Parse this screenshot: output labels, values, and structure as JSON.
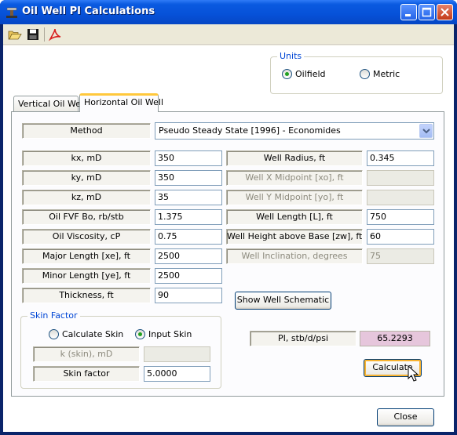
{
  "window": {
    "title": "Oil Well PI Calculations"
  },
  "toolbar": {
    "icons": [
      "open-folder-icon",
      "save-disk-icon",
      "pdf-icon"
    ]
  },
  "units": {
    "legend": "Units",
    "options": [
      {
        "label": "Oilfield",
        "selected": true
      },
      {
        "label": "Metric",
        "selected": false
      }
    ]
  },
  "tabs": [
    {
      "label": "Vertical Oil Well",
      "active": false
    },
    {
      "label": "Horizontal Oil Well",
      "active": true
    }
  ],
  "method": {
    "label": "Method",
    "value": "Pseudo Steady State [1996] - Economides"
  },
  "left_fields": [
    {
      "label": "kx, mD",
      "value": "350"
    },
    {
      "label": "ky, mD",
      "value": "350"
    },
    {
      "label": "kz, mD",
      "value": "35"
    },
    {
      "label": "Oil FVF Bo, rb/stb",
      "value": "1.375"
    },
    {
      "label": "Oil Viscosity, cP",
      "value": "0.75"
    },
    {
      "label": "Major Length [xe], ft",
      "value": "2500"
    },
    {
      "label": "Minor Length [ye], ft",
      "value": "2500"
    },
    {
      "label": "Thickness, ft",
      "value": "90"
    }
  ],
  "right_fields": [
    {
      "label": "Well Radius, ft",
      "value": "0.345"
    },
    {
      "label": "Well X Midpoint [xo], ft",
      "value": ""
    },
    {
      "label": "Well Y Midpoint [yo], ft",
      "value": ""
    },
    {
      "label": "Well Length [L], ft",
      "value": "750"
    },
    {
      "label": "Well Height above Base [zw], ft",
      "value": "60"
    },
    {
      "label": "Well Inclination, degrees",
      "value": "75"
    }
  ],
  "schematic_button": "Show Well Schematic",
  "skin": {
    "legend": "Skin Factor",
    "options": [
      {
        "label": "Calculate Skin",
        "selected": false
      },
      {
        "label": "Input Skin",
        "selected": true
      }
    ],
    "k_skin_label": "k (skin), mD",
    "k_skin_value": "",
    "skin_factor_label": "Skin factor",
    "skin_factor_value": "5.0000"
  },
  "result": {
    "label": "PI, stb/d/psi",
    "value": "65.2293"
  },
  "calculate_button": "Calculate",
  "close_button": "Close"
}
